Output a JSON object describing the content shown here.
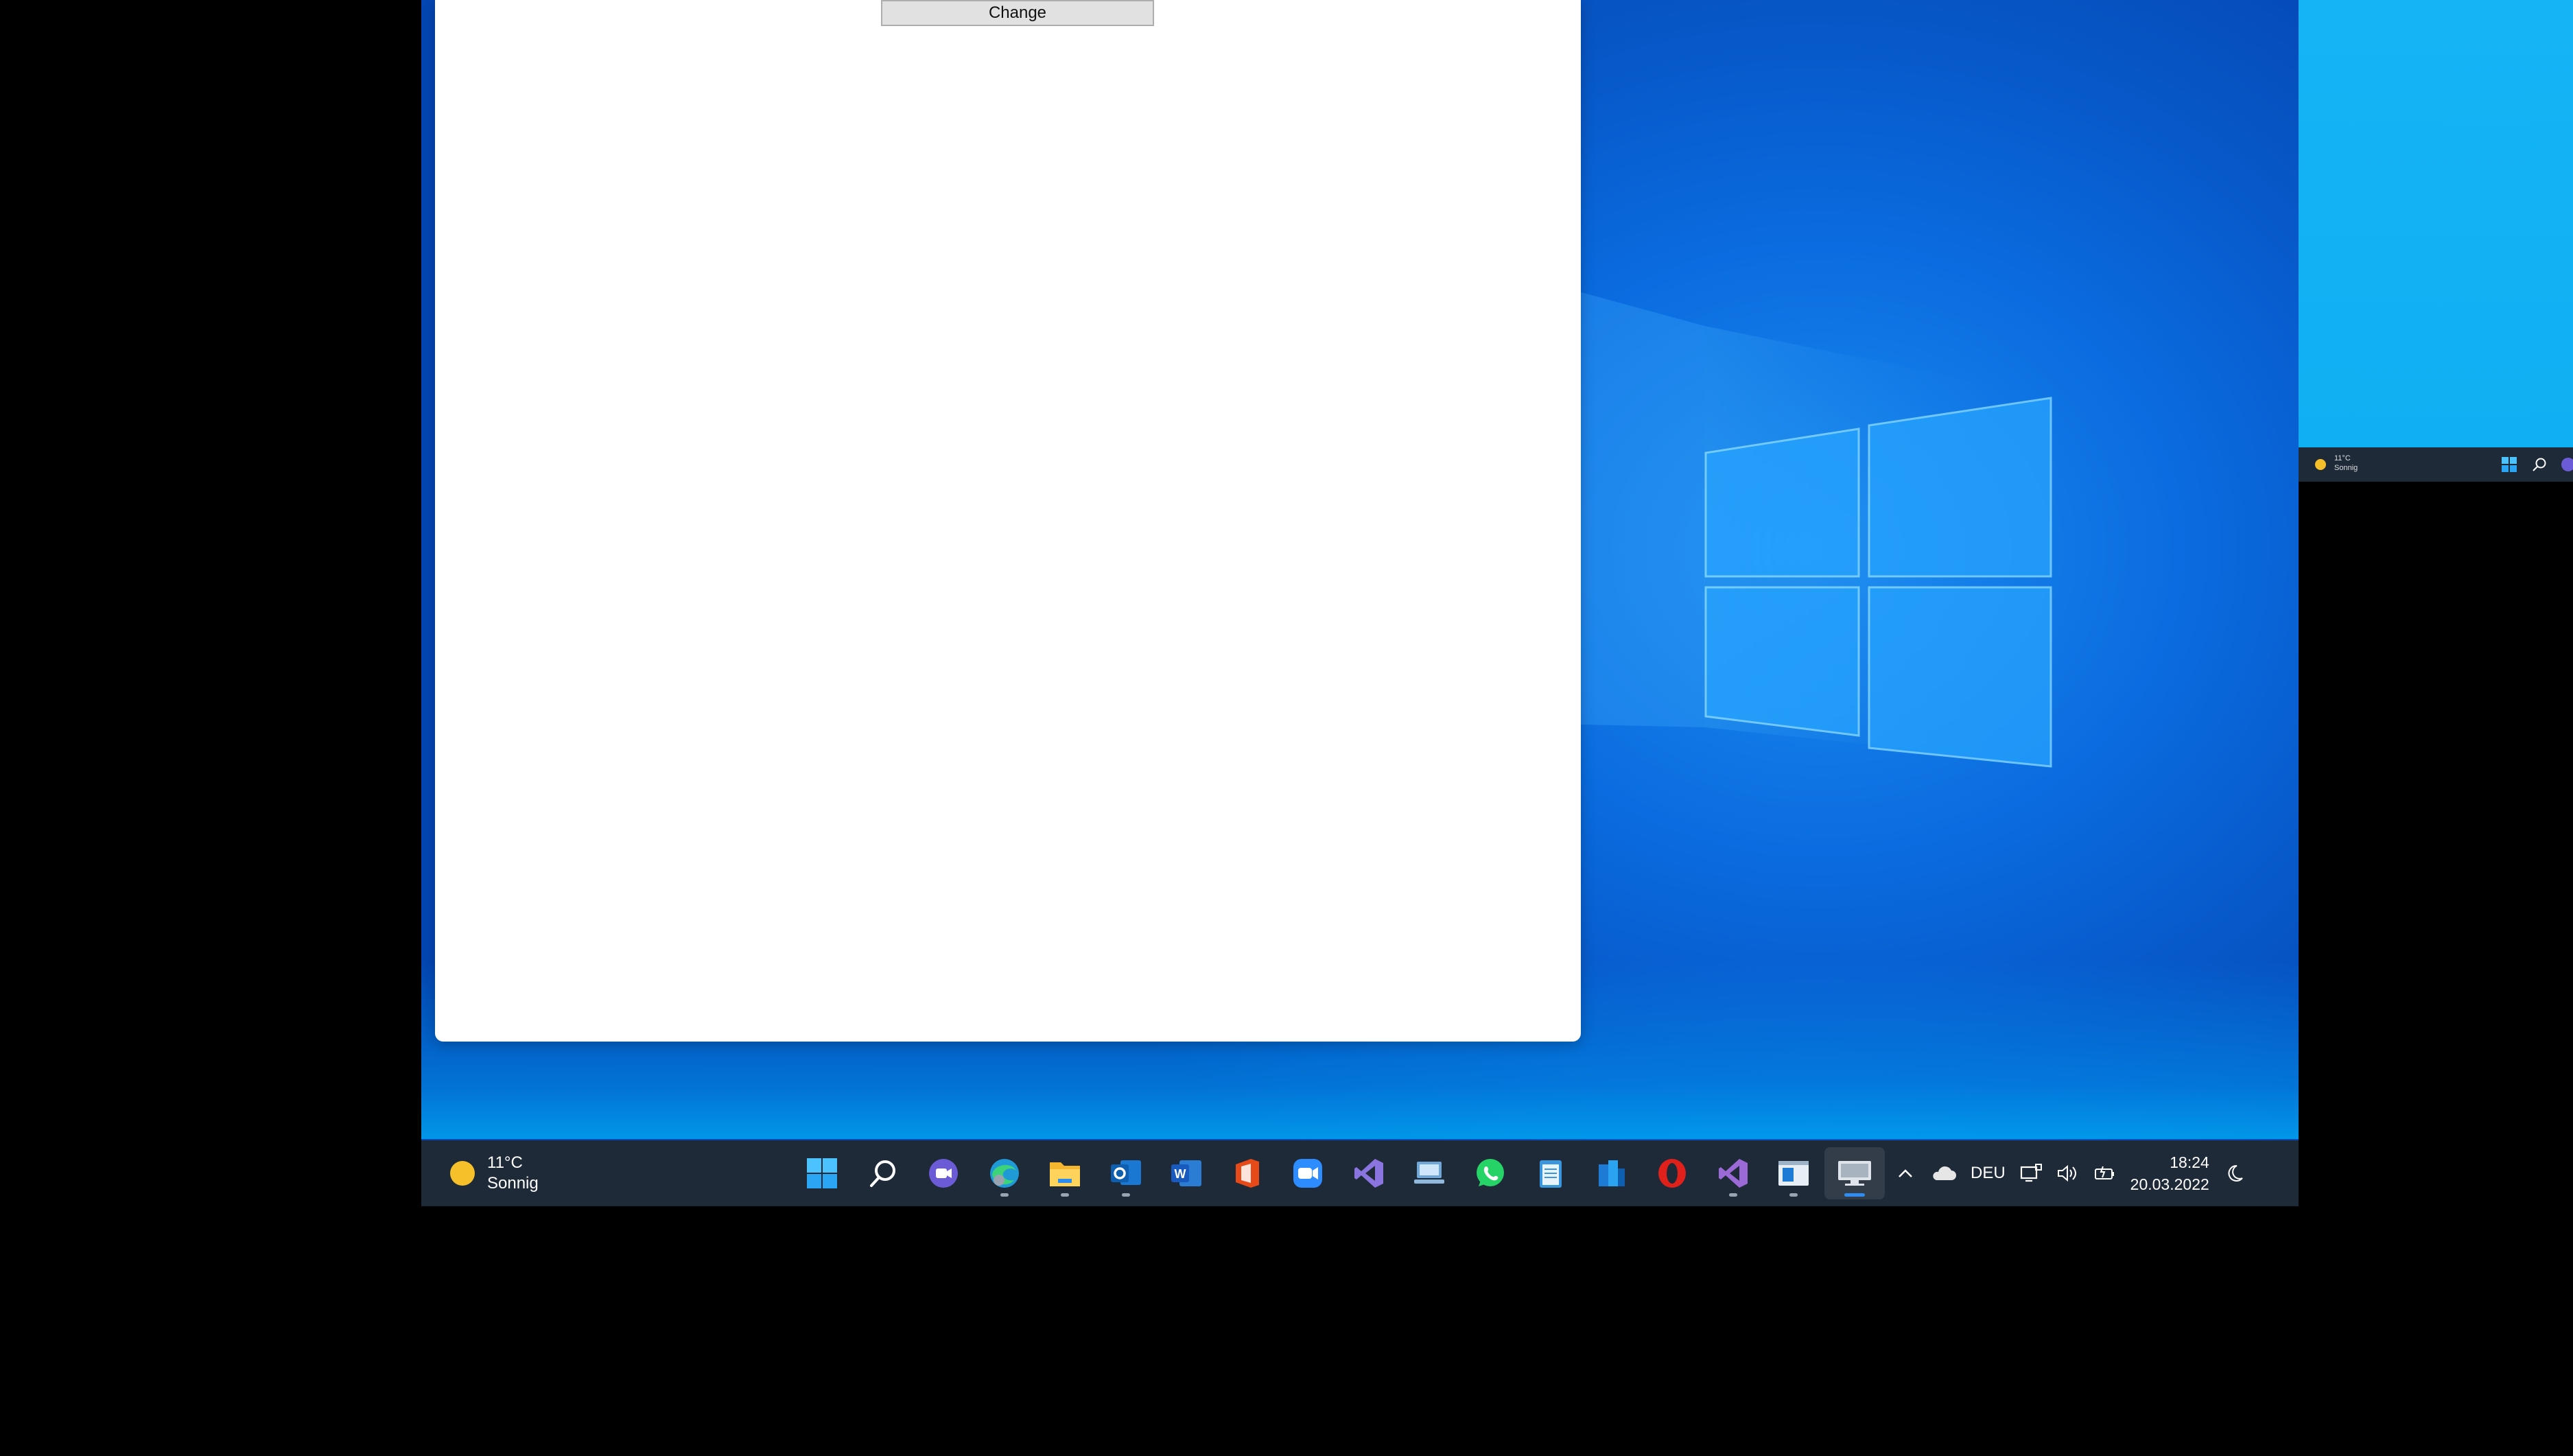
{
  "window": {
    "change_button_label": "Change"
  },
  "taskbar": {
    "weather": {
      "temperature": "11°C",
      "condition": "Sonnig"
    },
    "pinned_apps": [
      {
        "name": "start-icon"
      },
      {
        "name": "search-icon"
      },
      {
        "name": "teams-chat-icon"
      },
      {
        "name": "edge-icon",
        "running": true
      },
      {
        "name": "file-explorer-icon",
        "running": true
      },
      {
        "name": "outlook-icon",
        "running": true
      },
      {
        "name": "word-icon"
      },
      {
        "name": "office-icon"
      },
      {
        "name": "zoom-icon"
      },
      {
        "name": "visual-studio-code-icon"
      },
      {
        "name": "remote-desktop-icon"
      },
      {
        "name": "whatsapp-icon"
      },
      {
        "name": "notepad-icon"
      },
      {
        "name": "azure-data-studio-icon"
      },
      {
        "name": "opera-icon"
      },
      {
        "name": "visual-studio-icon",
        "running": true
      },
      {
        "name": "window-app-icon",
        "running": true
      },
      {
        "name": "screen-app-icon",
        "running": true,
        "active": true
      }
    ],
    "tray": {
      "language": "DEU",
      "time": "18:24",
      "date": "20.03.2022"
    }
  },
  "second_monitor": {
    "weather": {
      "temperature": "11°C",
      "condition": "Sonnig"
    }
  },
  "colors": {
    "taskbar_bg": "#1f2a38",
    "desktop_blue": "#0a6ce0",
    "accent": "#2f8cf0"
  }
}
